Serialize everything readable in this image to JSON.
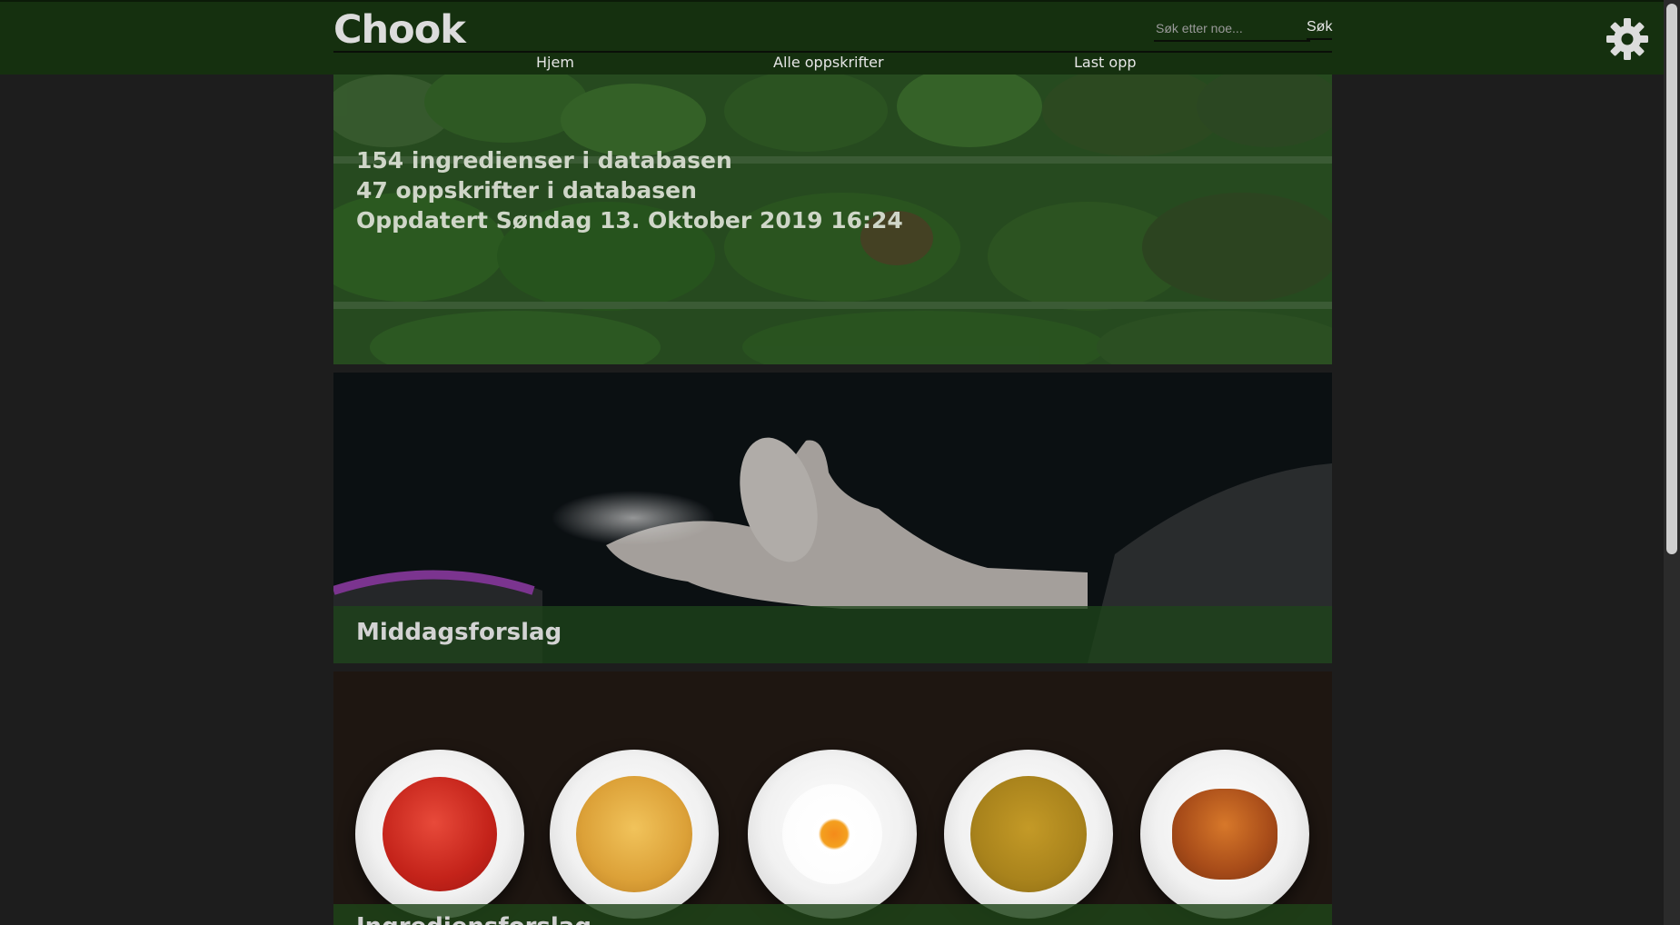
{
  "app": {
    "logo": "Chook"
  },
  "search": {
    "placeholder": "Søk etter noe...",
    "button_label": "Søk"
  },
  "nav": {
    "items": [
      {
        "label": "Hjem"
      },
      {
        "label": "Alle oppskrifter"
      },
      {
        "label": "Last opp"
      }
    ]
  },
  "icons": {
    "settings": "gear-icon"
  },
  "hero": {
    "line1": "154 ingredienser i databasen",
    "line2": "47 oppskrifter i databasen",
    "line3": "Oppdatert Søndag 13. Oktober 2019 16:24"
  },
  "cards": [
    {
      "title": "Middagsforslag"
    },
    {
      "title": "Ingrediensforslag"
    }
  ],
  "plates": [
    {
      "dish": "tomato-soup"
    },
    {
      "dish": "spaghetti"
    },
    {
      "dish": "fried-egg"
    },
    {
      "dish": "pea-soup"
    },
    {
      "dish": "croissant"
    }
  ],
  "colors": {
    "header_bg": "#15300f",
    "page_bg": "#1d1d1d",
    "caption_bg": "#1e4419"
  }
}
